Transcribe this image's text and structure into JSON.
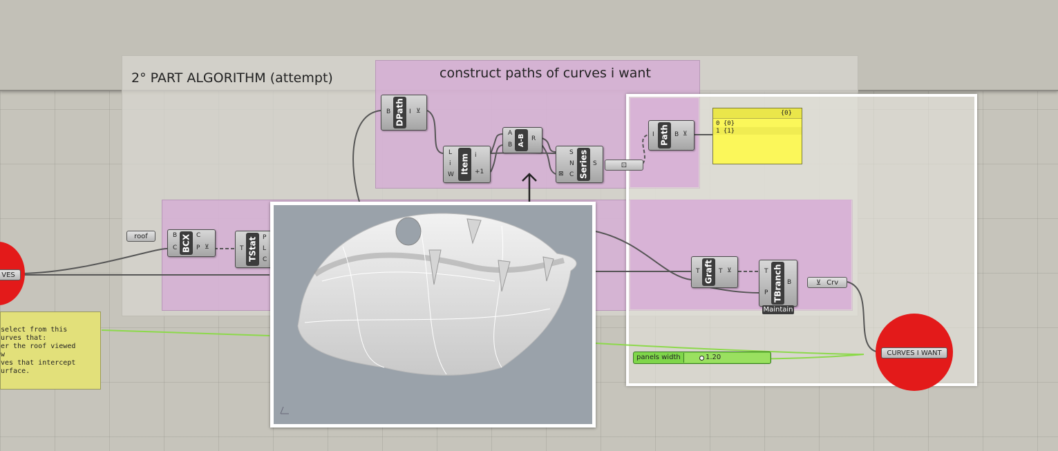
{
  "groups": {
    "main_title": "2° PART ALGORITHM (attempt)",
    "paths_title": "construct paths of curves i want"
  },
  "components": {
    "dpath": {
      "name": "DPath",
      "in": [
        "B"
      ],
      "out": [
        "I"
      ]
    },
    "item": {
      "name": "Item",
      "in": [
        "L",
        "i",
        "W"
      ],
      "out": [
        "i",
        "+1"
      ]
    },
    "ab": {
      "name": "A-B",
      "in": [
        "A",
        "B"
      ],
      "out": [
        "R"
      ]
    },
    "series": {
      "name": "Series",
      "in": [
        "S",
        "N",
        "C"
      ],
      "out": [
        "S"
      ]
    },
    "path": {
      "name": "Path",
      "in": [
        "I"
      ],
      "out": [
        "B"
      ]
    },
    "bcx": {
      "name": "BCX",
      "in": [
        "B",
        "C"
      ],
      "out": [
        "C",
        "P"
      ]
    },
    "tstat": {
      "name": "TStat",
      "in": [
        "T"
      ],
      "out": [
        "P",
        "L",
        "C"
      ]
    },
    "graft": {
      "name": "Graft",
      "in": [
        "T"
      ],
      "out": [
        "T"
      ]
    },
    "tbranch": {
      "name": "TBranch",
      "in": [
        "T",
        "P"
      ],
      "out": [
        "B"
      ],
      "mode": "Maintain"
    }
  },
  "params": {
    "roof": "roof",
    "crv": "Crv",
    "curves_left": "VES",
    "curves_i_want": "CURVES I WANT"
  },
  "panel": {
    "header": "{0}",
    "rows": [
      {
        "index": "0",
        "value": "{0}"
      },
      {
        "index": "1",
        "value": "{1}"
      }
    ]
  },
  "note": {
    "lines": [
      " select from this",
      "urves that:",
      "er the roof viewed",
      "w",
      "ves that intercept",
      "urface."
    ]
  },
  "slider": {
    "label": "panels width",
    "value": "1.20"
  },
  "colors": {
    "pink": "#d6aad6",
    "red": "#e31a1a",
    "yellow": "#fbf75a",
    "slider": "#7fd64a"
  }
}
